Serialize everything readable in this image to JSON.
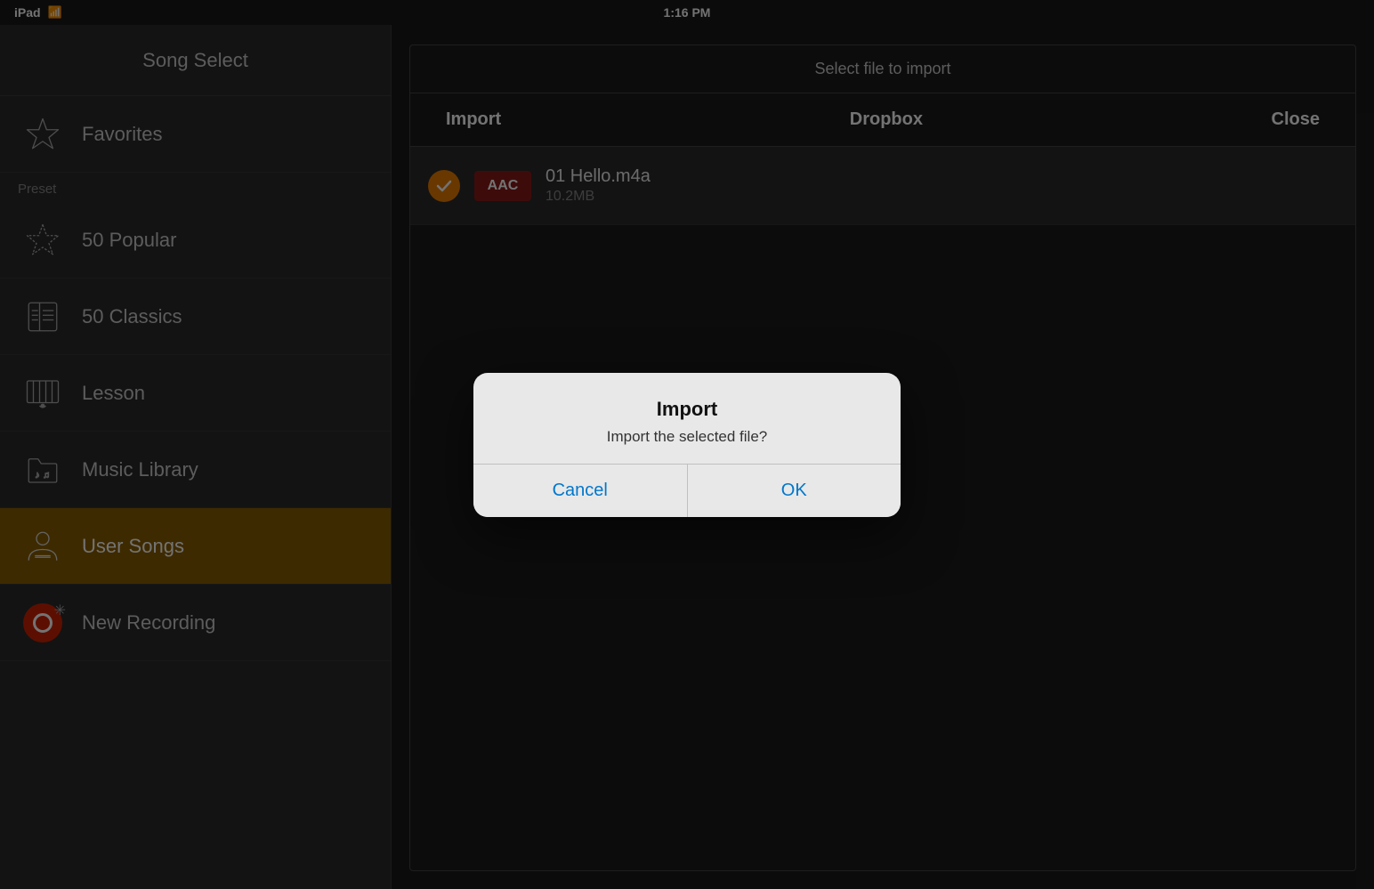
{
  "statusBar": {
    "device": "iPad",
    "wifi": "wifi",
    "time": "1:16 PM"
  },
  "sidebar": {
    "title": "Song Select",
    "sectionLabel": "Preset",
    "items": [
      {
        "id": "favorites",
        "label": "Favorites",
        "icon": "star"
      },
      {
        "id": "50popular",
        "label": "50 Popular",
        "icon": "star-sketch"
      },
      {
        "id": "50classics",
        "label": "50 Classics",
        "icon": "book"
      },
      {
        "id": "lesson",
        "label": "Lesson",
        "icon": "piano-hand"
      },
      {
        "id": "music-library",
        "label": "Music Library",
        "icon": "music-folder"
      },
      {
        "id": "user-songs",
        "label": "User Songs",
        "icon": "person",
        "active": true
      },
      {
        "id": "new-recording",
        "label": "New Recording",
        "icon": "record"
      }
    ]
  },
  "importPanel": {
    "title": "Select file to import",
    "toolbar": {
      "importLabel": "Import",
      "centerLabel": "Dropbox",
      "closeLabel": "Close"
    },
    "files": [
      {
        "name": "01 Hello.m4a",
        "size": "10.2MB",
        "format": "AAC",
        "selected": true
      }
    ]
  },
  "alertDialog": {
    "title": "Import",
    "message": "Import the selected file?",
    "cancelLabel": "Cancel",
    "okLabel": "OK"
  }
}
